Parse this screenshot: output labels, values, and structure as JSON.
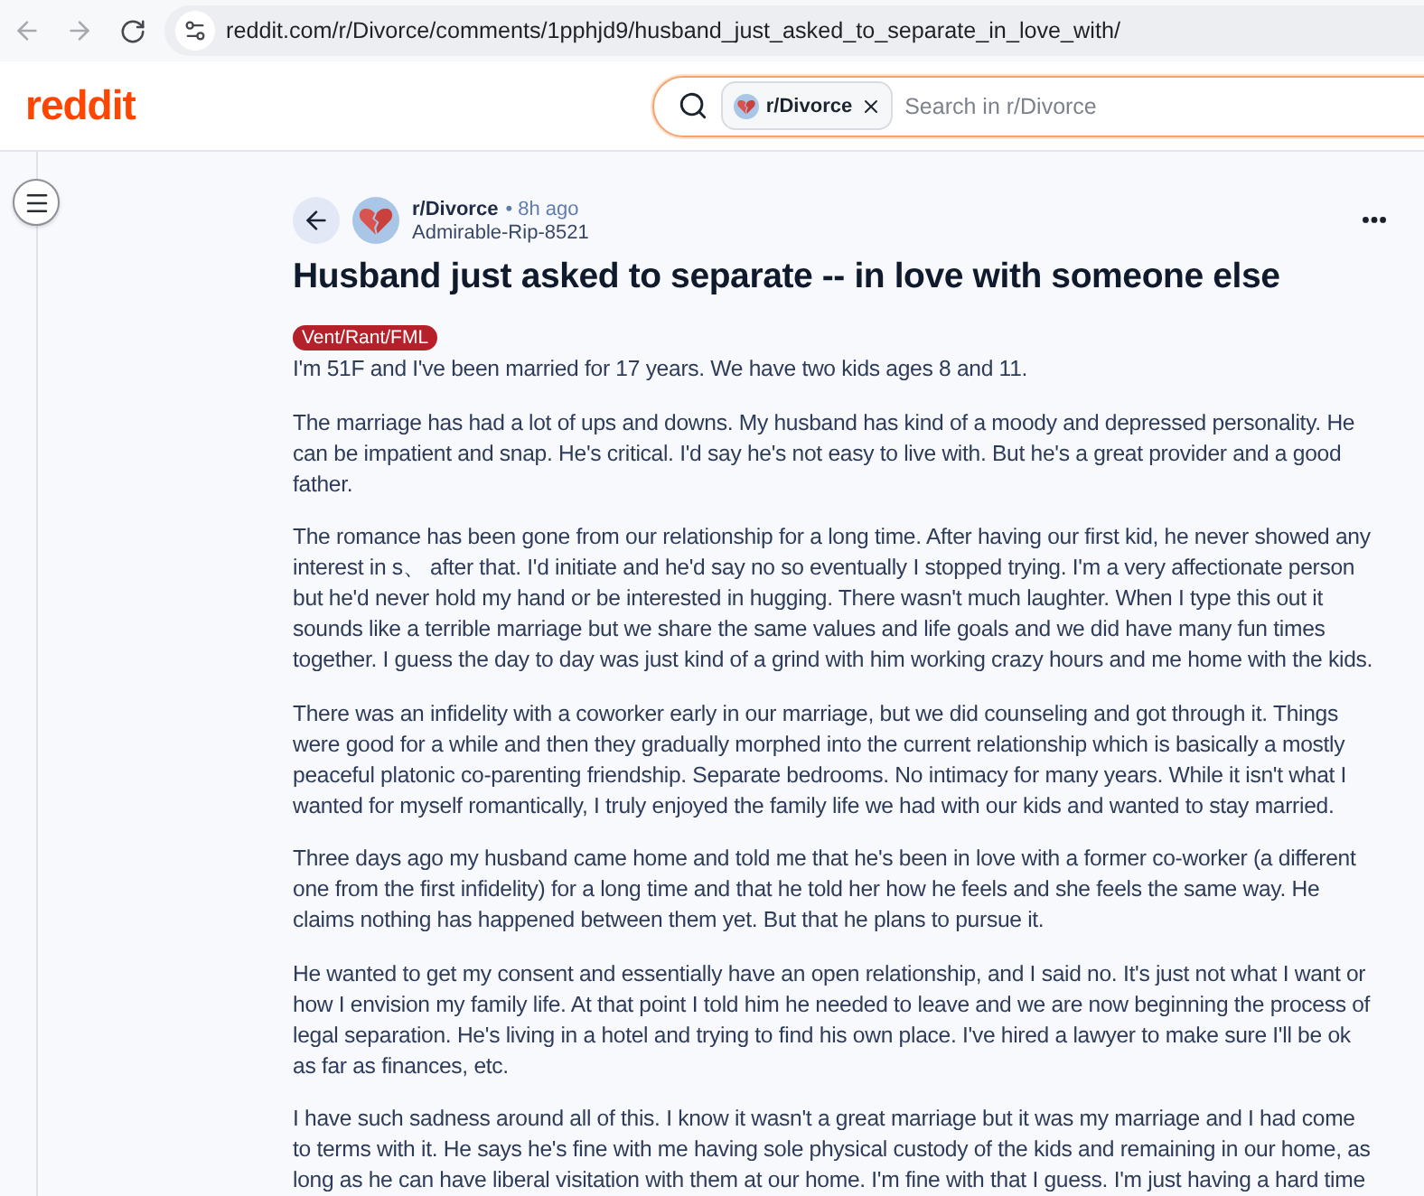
{
  "browser": {
    "url": "reddit.com/r/Divorce/comments/1pphjd9/husband_just_asked_to_separate_in_love_with/"
  },
  "header": {
    "logo": "reddit",
    "search": {
      "chip": "r/Divorce",
      "placeholder": "Search in r/Divorce"
    }
  },
  "post": {
    "subreddit": "r/Divorce",
    "time": "• 8h ago",
    "author": "Admirable-Rip-8521",
    "title": "Husband just asked to separate -- in love with someone else",
    "flair": "Vent/Rant/FML",
    "paragraphs": [
      "I'm 51F and I've been married for 17 years. We have two kids ages 8 and 11.",
      "The marriage has had a lot of ups and downs. My husband has kind of a moody and depressed personality. He can be impatient and snap. He's critical. I'd say he's not easy to live with. But he's a great provider and a good father.",
      "The romance has been gone from our relationship for a long time. After having our first kid, he never showed any interest in s、 after that. I'd initiate and he'd say no so eventually I stopped trying. I'm a very affectionate person but he'd never hold my hand or be interested in hugging. There wasn't much laughter. When I type this out it sounds like a terrible marriage but we share the same values and life goals and we did have many fun times together. I guess the day to day was just kind of a grind with him working crazy hours and me home with the kids.",
      "There was an infidelity with a coworker early in our marriage, but we did counseling and got through it. Things were good for a while and then they gradually morphed into the current relationship which is basically a mostly peaceful platonic co-parenting friendship. Separate bedrooms. No intimacy for many years. While it isn't what I wanted for myself romantically, I truly enjoyed the family life we had with our kids and wanted to stay married.",
      "Three days ago my husband came home and told me that he's been in love with a former co-worker (a different one from the first infidelity) for a long time and that he told her how he feels and she feels the same way. He claims nothing has happened between them yet. But that he plans to pursue it.",
      "He wanted to get my consent and essentially have an open relationship, and I said no. It's just not what I want or how I envision my family life. At that point I told him he needed to leave and we are now beginning the process of legal separation. He's living in a hotel and trying to find his own place. I've hired a lawyer to make sure I'll be ok as far as finances, etc.",
      "I have such sadness around all of this. I know it wasn't a great marriage but it was my marriage and I had come to terms with it. He says he's fine with me having sole physical custody of the kids and remaining in our home, as long as he can have liberal visitation with them at our home. I'm fine with that I guess. I'm just having a hard time"
    ]
  }
}
